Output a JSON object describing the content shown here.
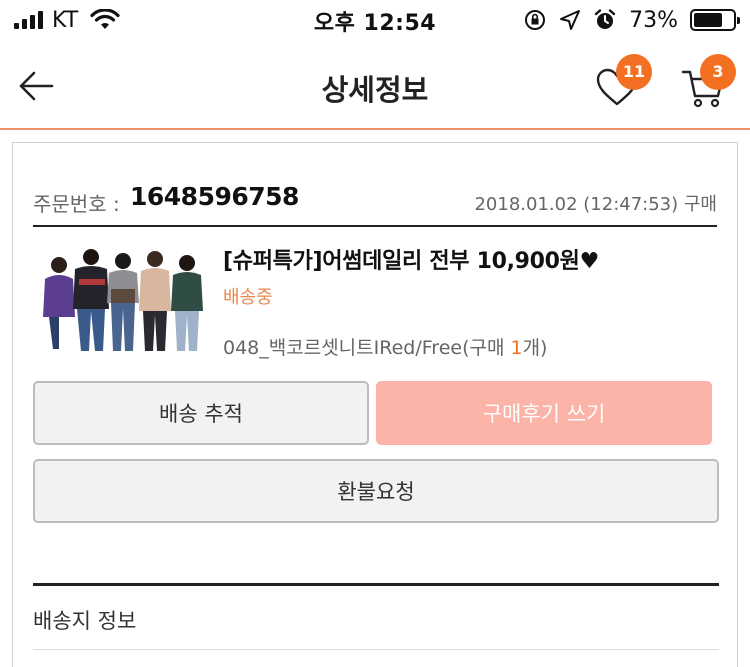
{
  "status_bar": {
    "carrier": "KT",
    "time": "오후 12:54",
    "battery_percent": "73%",
    "battery_level": 0.73,
    "icons": [
      "signal-icon",
      "wifi-icon",
      "rotation-lock-icon",
      "location-arrow-icon",
      "alarm-icon",
      "battery-icon"
    ]
  },
  "nav": {
    "title": "상세정보",
    "wishlist_count": "11",
    "cart_count": "3",
    "back_icon": "arrow-left-icon",
    "wishlist_icon": "heart-icon",
    "cart_icon": "cart-icon"
  },
  "order": {
    "label": "주문번호 :",
    "number": "1648596758",
    "date": "2018.01.02 (12:47:53) 구매"
  },
  "product": {
    "title": "[슈퍼특가]어썸데일리 전부 10,900원♥",
    "status": "배송중",
    "option_prefix": "048_백코르셋니트IRed/Free(구매 ",
    "quantity": "1",
    "option_suffix": "개)"
  },
  "buttons": {
    "track": "배송 추적",
    "review": "구매후기 쓰기",
    "refund": "환불요청"
  },
  "shipping": {
    "section_title": "배송지 정보"
  },
  "colors": {
    "accent": "#f36f21",
    "status_text": "#e8874f",
    "review_button": "#fcb3a8",
    "nav_underline": "#f0906a"
  }
}
